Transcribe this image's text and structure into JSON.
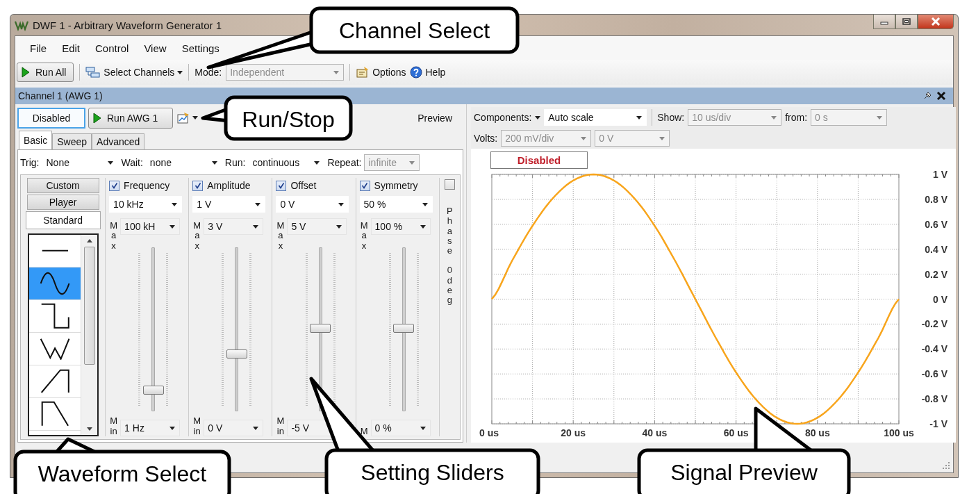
{
  "window": {
    "title": "DWF 1 - Arbitrary Waveform Generator 1"
  },
  "menu": [
    "File",
    "Edit",
    "Control",
    "View",
    "Settings"
  ],
  "toolbar": {
    "run_all": "Run  All",
    "select_channels": "Select Channels",
    "mode_label": "Mode:",
    "mode_value": "Independent",
    "options": "Options",
    "help": "Help"
  },
  "channel": {
    "title": "Channel 1 (AWG 1)",
    "enable_button": "Disabled",
    "run_button": "Run  AWG 1",
    "preview_label": "Preview"
  },
  "tabs": [
    {
      "label": "Basic",
      "selected": true
    },
    {
      "label": "Sweep",
      "selected": false
    },
    {
      "label": "Advanced",
      "selected": false
    }
  ],
  "trigger_row": [
    {
      "label": "Trig:",
      "value": "None",
      "disabled": false
    },
    {
      "label": "Wait:",
      "value": "none",
      "disabled": false
    },
    {
      "label": "Run:",
      "value": "continuous",
      "disabled": false
    },
    {
      "label": "Repeat:",
      "value": "infinite",
      "disabled": true
    }
  ],
  "waveform_tabs": [
    {
      "label": "Custom",
      "selected": false
    },
    {
      "label": "Player",
      "selected": false
    },
    {
      "label": "Standard",
      "selected": true
    }
  ],
  "waveforms": [
    {
      "kind": "dc",
      "selected": false
    },
    {
      "kind": "sine",
      "selected": true
    },
    {
      "kind": "square",
      "selected": false
    },
    {
      "kind": "triangle",
      "selected": false
    },
    {
      "kind": "ramp_up",
      "selected": false
    },
    {
      "kind": "ramp_down",
      "selected": false
    }
  ],
  "parameters": [
    {
      "name": "Frequency",
      "checked": true,
      "value": "10 kHz",
      "max_label": "Max",
      "max": "100 kH",
      "min_label": "Min",
      "min": "1 Hz",
      "level": 0.13
    },
    {
      "name": "Amplitude",
      "checked": true,
      "value": "1 V",
      "max_label": "Max",
      "max": "3 V",
      "min_label": "Min",
      "min": "0 V",
      "level": 0.35
    },
    {
      "name": "Offset",
      "checked": true,
      "value": "0 V",
      "max_label": "Max",
      "max": "5 V",
      "min_label": "Min",
      "min": "-5 V",
      "level": 0.51
    },
    {
      "name": "Symmetry",
      "checked": true,
      "value": "50 %",
      "max_label": "Max",
      "max": "100 %",
      "min_label": "M",
      "min": "0 %",
      "level": 0.51
    }
  ],
  "phase": {
    "checked": false,
    "label": "Phase",
    "value": "0 deg"
  },
  "preview": {
    "components_label": "Components:",
    "scale_value": "Auto scale",
    "show_label": "Show:",
    "show_value": "10 us/div",
    "from_label": "from:",
    "from_value": "0 s",
    "volts_label": "Volts:",
    "volts_value": "200 mV/div",
    "volts_offset": "0 V",
    "status": "Disabled",
    "chart_data": {
      "type": "line",
      "grid": true,
      "x": [
        0,
        5,
        10,
        15,
        20,
        25,
        30,
        35,
        40,
        45,
        50,
        55,
        60,
        65,
        70,
        75,
        80,
        85,
        90,
        95,
        100
      ],
      "values": [
        0,
        0.309,
        0.588,
        0.809,
        0.951,
        1,
        0.951,
        0.809,
        0.588,
        0.309,
        0,
        -0.309,
        -0.588,
        -0.809,
        -0.951,
        -1,
        -0.951,
        -0.809,
        -0.588,
        -0.309,
        0
      ],
      "xlim": [
        0,
        100
      ],
      "ylim": [
        -1,
        1
      ],
      "xticks": [
        {
          "value": 0,
          "label": "0 us"
        },
        {
          "value": 20,
          "label": "20 us"
        },
        {
          "value": 40,
          "label": "40 us"
        },
        {
          "value": 60,
          "label": "60 us"
        },
        {
          "value": 80,
          "label": "80 us"
        },
        {
          "value": 100,
          "label": "100 us"
        }
      ],
      "yticks": [
        {
          "value": 1,
          "label": "1 V"
        },
        {
          "value": 0.8,
          "label": "0.8 V"
        },
        {
          "value": 0.6,
          "label": "0.6 V"
        },
        {
          "value": 0.4,
          "label": "0.4 V"
        },
        {
          "value": 0.2,
          "label": "0.2 V"
        },
        {
          "value": 0,
          "label": "0 V"
        },
        {
          "value": -0.2,
          "label": "-0.2 V"
        },
        {
          "value": -0.4,
          "label": "-0.4 V"
        },
        {
          "value": -0.6,
          "label": "-0.6 V"
        },
        {
          "value": -0.8,
          "label": "-0.8 V"
        },
        {
          "value": -1,
          "label": "-1 V"
        }
      ]
    }
  },
  "callouts": [
    "Channel Select",
    "Run/Stop",
    "Waveform Select",
    "Setting Sliders",
    "Signal Preview"
  ]
}
